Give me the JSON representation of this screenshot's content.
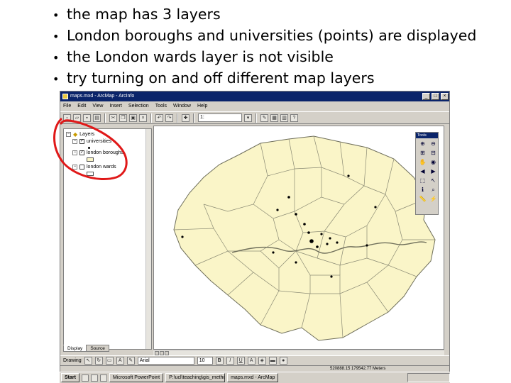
{
  "bullets": [
    "the map has 3 layers",
    "London boroughs and universities (points) are displayed",
    "the London wards layer is not visible",
    "try turning on and off different map layers"
  ],
  "window": {
    "title": "maps.mxd - ArcMap - ArcInfo",
    "menu": [
      "File",
      "Edit",
      "View",
      "Insert",
      "Selection",
      "Tools",
      "Window",
      "Help"
    ],
    "scale": "1:"
  },
  "toc": {
    "root": "Layers",
    "layers": [
      {
        "name": "universities",
        "checked": true
      },
      {
        "name": "london boroughs",
        "checked": true
      },
      {
        "name": "london wards",
        "checked": false
      }
    ],
    "tabs": [
      "Display",
      "Source"
    ]
  },
  "tools_title": "Tools",
  "drawbar": {
    "drawing": "Drawing",
    "font": "Arial",
    "size": "10"
  },
  "status": {
    "coord": "520888.15  179542.77 Meters"
  },
  "taskbar": {
    "start": "Start",
    "tasks": [
      "Microsoft PowerPoint",
      "P:\\ucl\\teaching\\gis_methods",
      "maps.mxd - ArcMap"
    ]
  },
  "colors": {
    "land": "#faf5c8",
    "border": "#6e6e5a",
    "annotation": "#e01818",
    "titlebar": "#0a246a"
  }
}
